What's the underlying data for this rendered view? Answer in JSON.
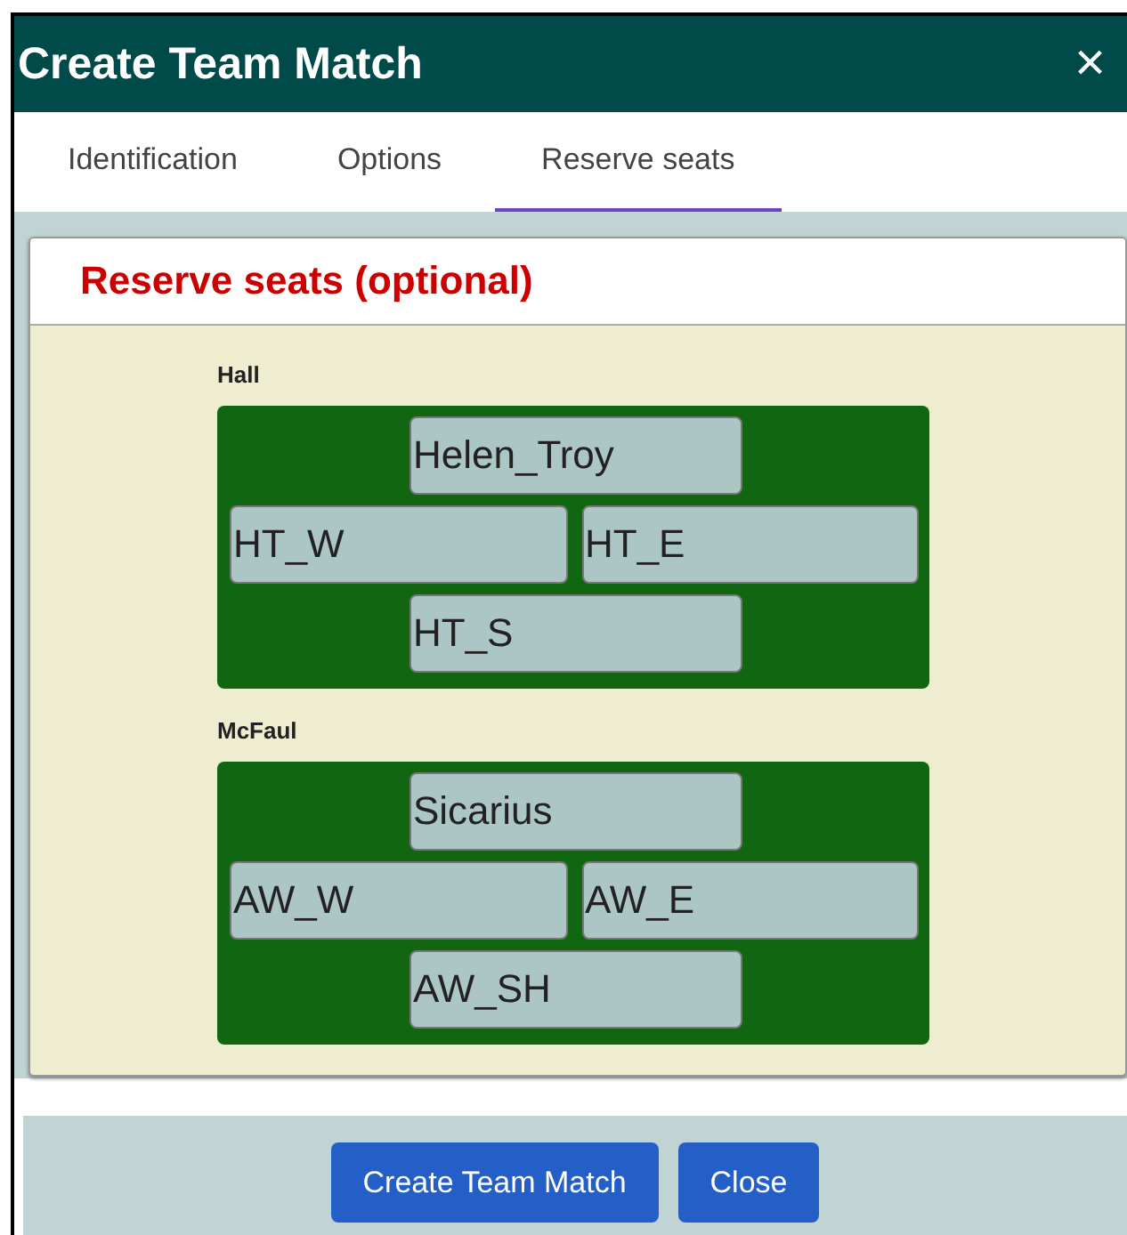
{
  "window": {
    "title": "Create Team Match",
    "close": "×"
  },
  "tabs": [
    {
      "label": "Identification",
      "selected": false
    },
    {
      "label": "Options",
      "selected": false
    },
    {
      "label": "Reserve seats",
      "selected": true
    }
  ],
  "panel": {
    "heading": "Reserve seats (optional)",
    "tables": [
      {
        "name": "Hall",
        "seats": [
          {
            "kind": "north",
            "player": "Helen_Troy"
          },
          {
            "kind": "west",
            "player": "HT_W"
          },
          {
            "kind": "east",
            "player": "HT_E"
          },
          {
            "kind": "south",
            "player": "HT_S"
          }
        ]
      },
      {
        "name": "McFaul",
        "seats": [
          {
            "kind": "north",
            "player": "Sicarius"
          },
          {
            "kind": "west",
            "player": "AW_W"
          },
          {
            "kind": "east",
            "player": "AW_E"
          },
          {
            "kind": "south",
            "player": "AW_SH"
          }
        ]
      }
    ]
  },
  "buttons": [
    "Create Team Match",
    "Close"
  ]
}
